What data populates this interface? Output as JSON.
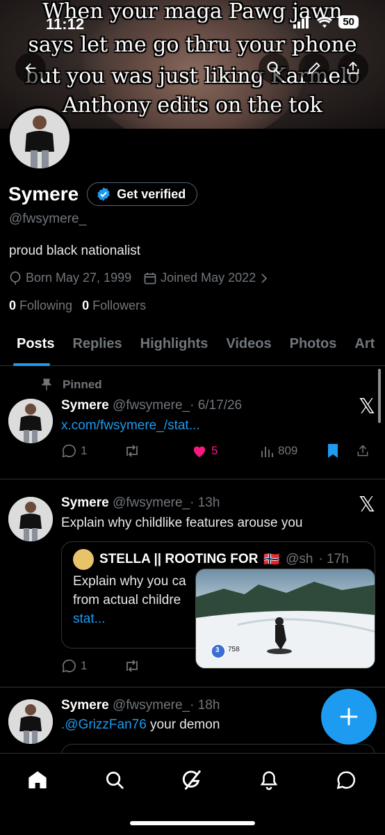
{
  "status_bar": {
    "time": "11:12",
    "battery": "50"
  },
  "banner": {
    "meme_lines": [
      "When your maga Pawg jawn",
      "says let me go thru your phone",
      "but you was just liking Karmelo",
      "Anthony edits on the tok"
    ]
  },
  "profile": {
    "name": "Symere",
    "get_verified": "Get verified",
    "handle": "@fwsymere_",
    "bio": "proud black nationalist",
    "born": "Born May 27, 1999",
    "joined": "Joined May 2022",
    "following_count": "0",
    "following_label": "Following",
    "followers_count": "0",
    "followers_label": "Followers"
  },
  "tabs": [
    "Posts",
    "Replies",
    "Highlights",
    "Videos",
    "Photos",
    "Art"
  ],
  "posts": [
    {
      "pinned_label": "Pinned",
      "name": "Symere",
      "handle": "@fwsymere_",
      "time": "· 6/17/26",
      "text": "x.com/fwsymere_/stat...",
      "replies": "1",
      "likes": "5",
      "views": "809"
    },
    {
      "name": "Symere",
      "handle": "@fwsymere_",
      "time": "· 13h",
      "text": "Explain why childlike features arouse you",
      "quote": {
        "name": "STELLA || ROOTING FOR",
        "flag": "🇳🇴",
        "handle": "@sh",
        "time": "· 17h",
        "line1": "Explain why you ca",
        "line2": "from actual childre",
        "line3": "stat..."
      },
      "replies": "1"
    },
    {
      "name": "Symere",
      "handle": "@fwsymere_",
      "time": "· 18h",
      "mention": ".@GrizzFan76",
      "text_rest": " your demon"
    }
  ],
  "video_overlay": {
    "badge": "3",
    "value": "758"
  },
  "icons": {
    "back": "back-arrow-icon",
    "search": "search-icon",
    "edit": "pencil-icon",
    "share": "share-icon",
    "home": "home-icon",
    "explore": "search-icon",
    "grok": "grok-icon",
    "notifications": "bell-icon",
    "messages": "chat-icon"
  },
  "colors": {
    "accent": "#1d9bf0",
    "like": "#f91880",
    "background": "#000000",
    "muted": "#71767b"
  }
}
